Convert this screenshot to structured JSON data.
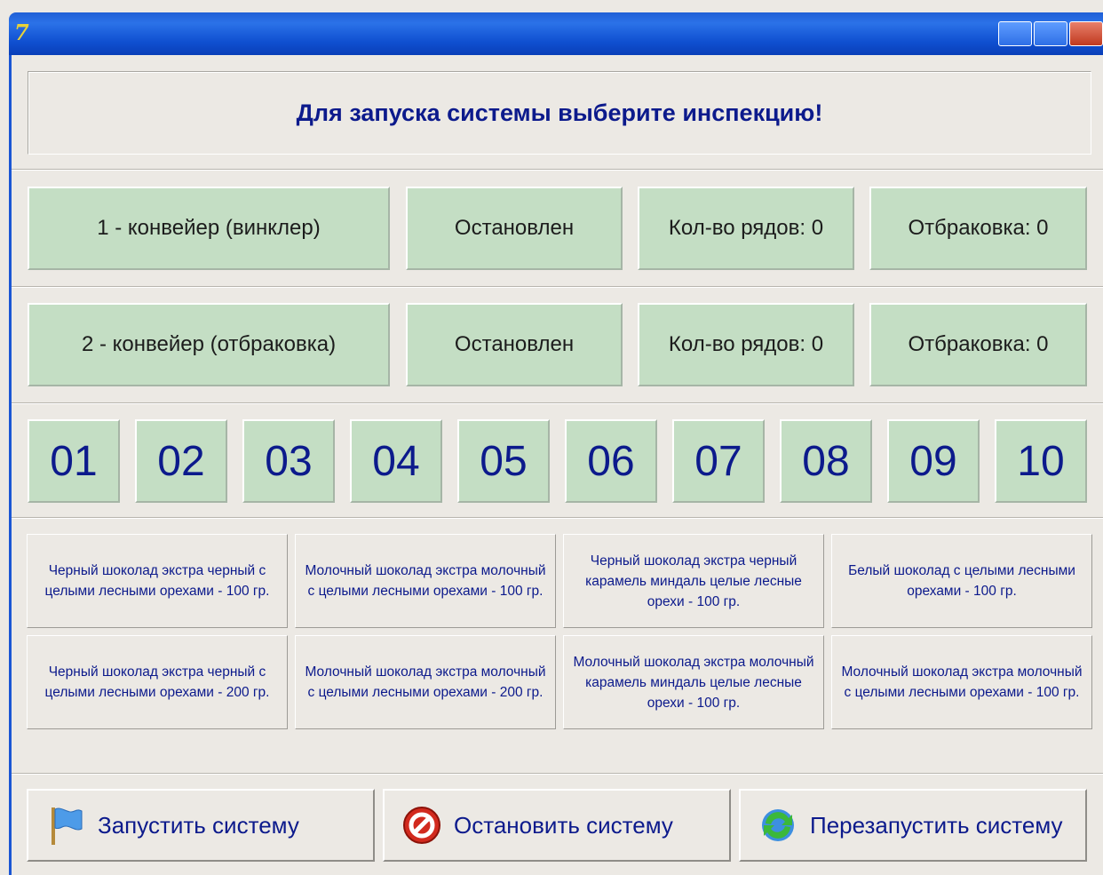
{
  "window": {
    "title": ""
  },
  "header": {
    "message": "Для запуска системы выберите инспекцию!"
  },
  "conveyors": [
    {
      "name": "1 - конвейер (винклер)",
      "status": "Остановлен",
      "rows": "Кол-во рядов: 0",
      "reject": "Отбраковка: 0"
    },
    {
      "name": "2 - конвейер (отбраковка)",
      "status": "Остановлен",
      "rows": "Кол-во рядов: 0",
      "reject": "Отбраковка: 0"
    }
  ],
  "slots": [
    "01",
    "02",
    "03",
    "04",
    "05",
    "06",
    "07",
    "08",
    "09",
    "10"
  ],
  "products": [
    "Черный шоколад экстра черный с целыми лесными орехами - 100 гр.",
    "Молочный шоколад экстра молочный с целыми лесными орехами - 100 гр.",
    "Черный шоколад экстра черный карамель миндаль целые лесные орехи - 100 гр.",
    "Белый шоколад с целыми лесными орехами - 100 гр.",
    "Черный шоколад экстра черный с целыми лесными орехами - 200 гр.",
    "Молочный шоколад экстра молочный с целыми лесными орехами - 200 гр.",
    "Молочный шоколад экстра молочный карамель миндаль целые лесные орехи - 100 гр.",
    "Молочный шоколад экстра молочный с целыми лесными орехами - 100 гр."
  ],
  "actions": {
    "start": "Запустить систему",
    "stop": "Остановить систему",
    "restart": "Перезапустить систему"
  },
  "colors": {
    "panel": "#c4dec4",
    "text_blue": "#0c1a8c",
    "background": "#ece9e4"
  },
  "icons": {
    "start": "flag-icon",
    "stop": "stop-icon",
    "restart": "refresh-icon"
  }
}
